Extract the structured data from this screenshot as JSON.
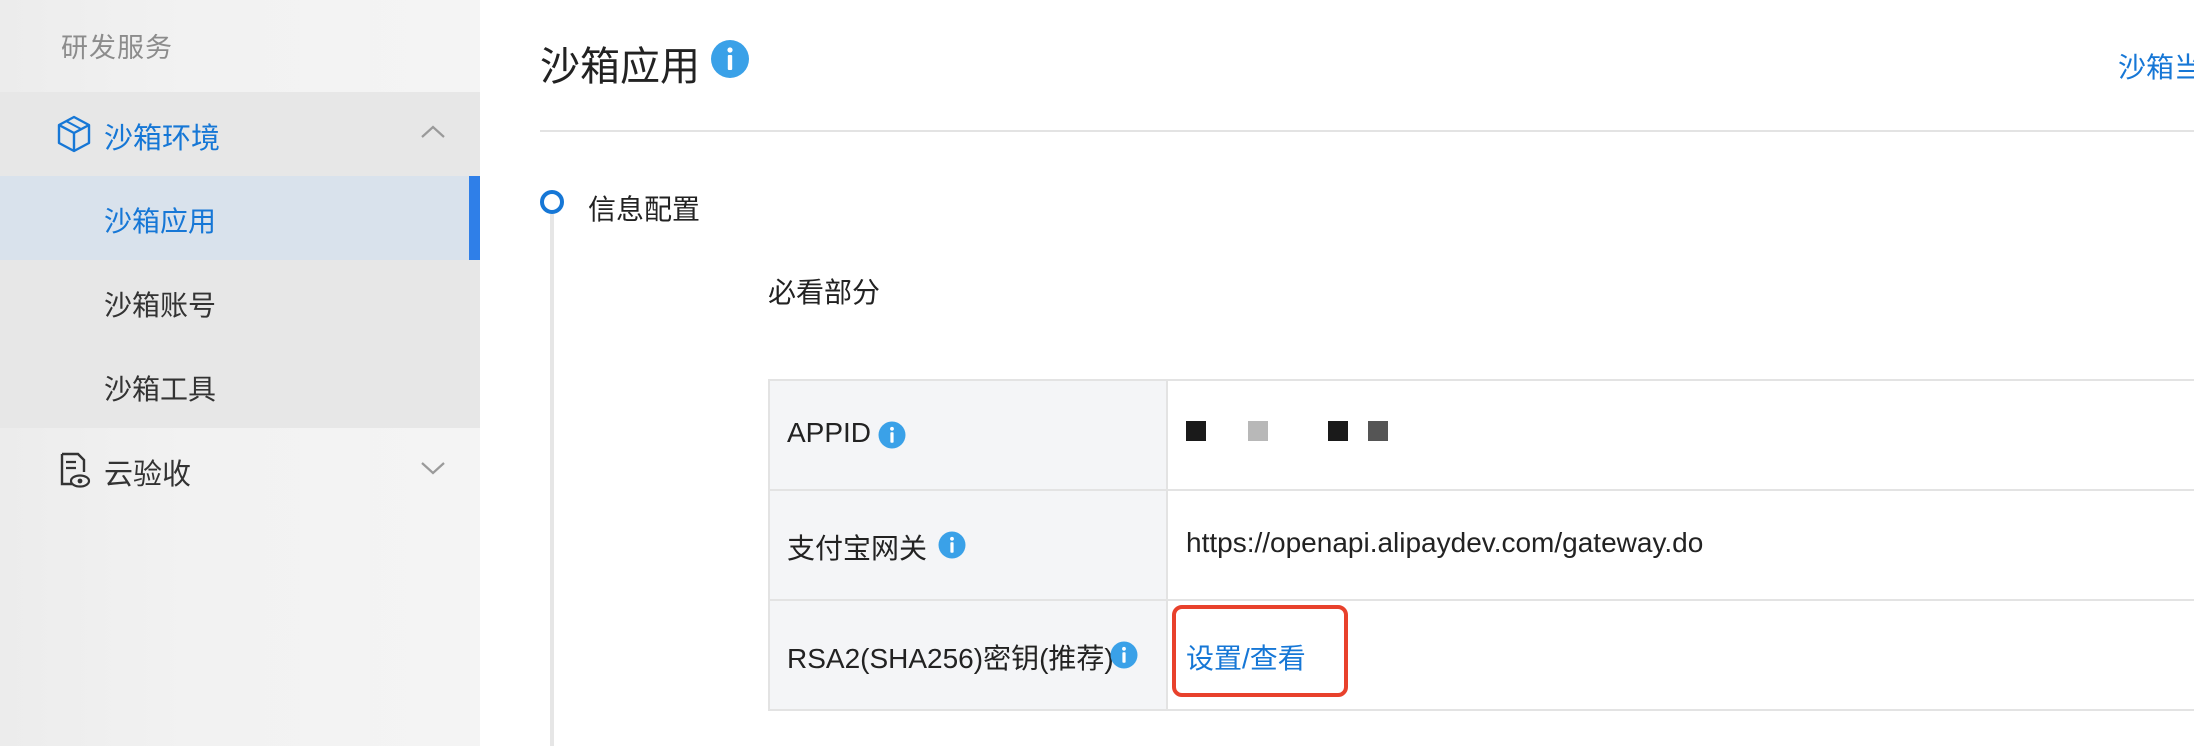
{
  "sidebar": {
    "section_title": "研发服务",
    "groups": [
      {
        "label": "沙箱环境",
        "expanded": true,
        "children": [
          {
            "label": "沙箱应用",
            "active": true
          },
          {
            "label": "沙箱账号",
            "active": false
          },
          {
            "label": "沙箱工具",
            "active": false
          }
        ]
      },
      {
        "label": "云验收",
        "expanded": false
      }
    ]
  },
  "main": {
    "title": "沙箱应用",
    "top_right_link": "沙箱当",
    "step_title": "信息配置",
    "section_subtitle": "必看部分",
    "rows": [
      {
        "label": "APPID",
        "value": ""
      },
      {
        "label": "支付宝网关",
        "value": "https://openapi.alipaydev.com/gateway.do"
      },
      {
        "label": "RSA2(SHA256)密钥(推荐)",
        "link": "设置/查看"
      }
    ]
  },
  "colors": {
    "accent": "#1677d6",
    "info_icon": "#3aa1e8",
    "highlight": "#e8412c",
    "active_bar": "#2f7fe8"
  },
  "icons": {
    "info": "info-icon",
    "box": "box-icon",
    "doc": "document-eye-icon",
    "chevron_up": "chevron-up-icon",
    "chevron_down": "chevron-down-icon"
  }
}
